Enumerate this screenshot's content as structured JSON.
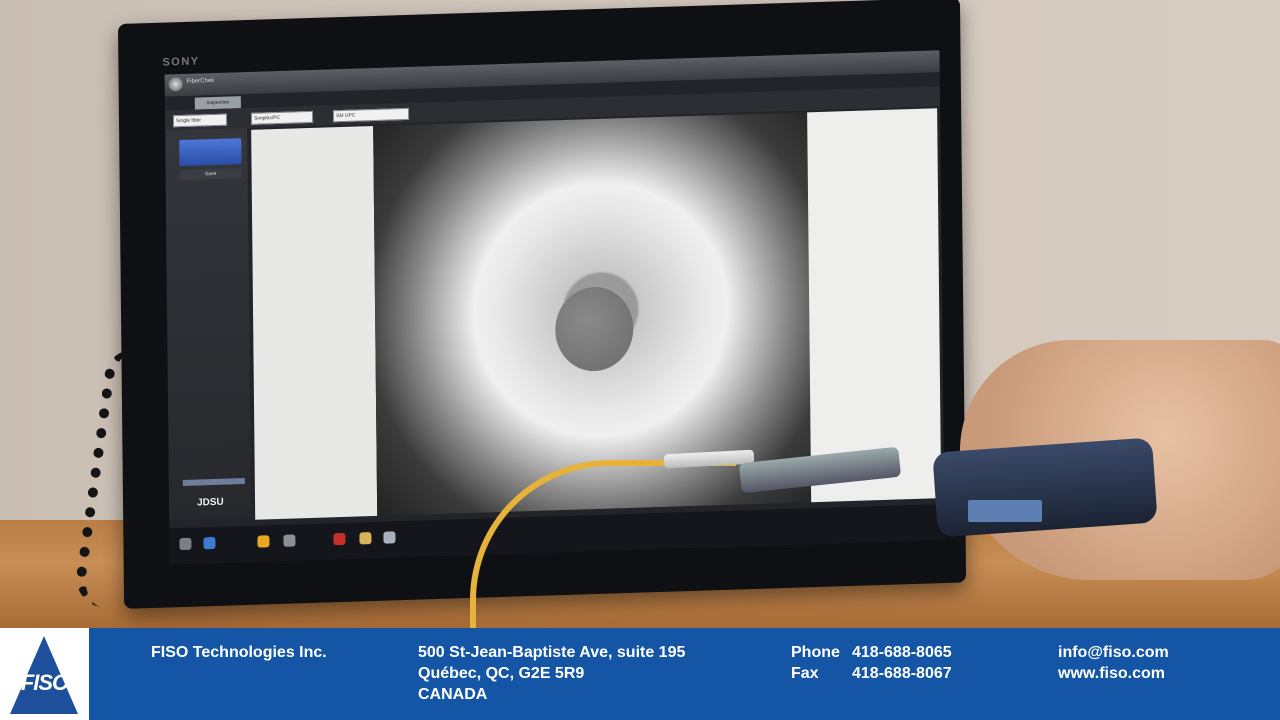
{
  "monitor": {
    "brand": "SONY",
    "app": {
      "title": "FiberChek",
      "tab": "Inspection",
      "field_1": "Single fiber",
      "field_2": "Simplex/PC",
      "field_3": "SM UPC",
      "save_label": "Save",
      "vendor_logo": "JDSU"
    }
  },
  "banner": {
    "company": "FISO Technologies Inc.",
    "address_line1": "500 St-Jean-Baptiste Ave, suite 195",
    "address_line2": "Québec, QC, G2E 5R9",
    "address_line3": "CANADA",
    "phone_label": "Phone",
    "phone": "418-688-8065",
    "fax_label": "Fax",
    "fax": "418-688-8067",
    "email": "info@fiso.com",
    "website": "www.fiso.com",
    "logo_text": "FISO",
    "color": "#1456a5"
  }
}
